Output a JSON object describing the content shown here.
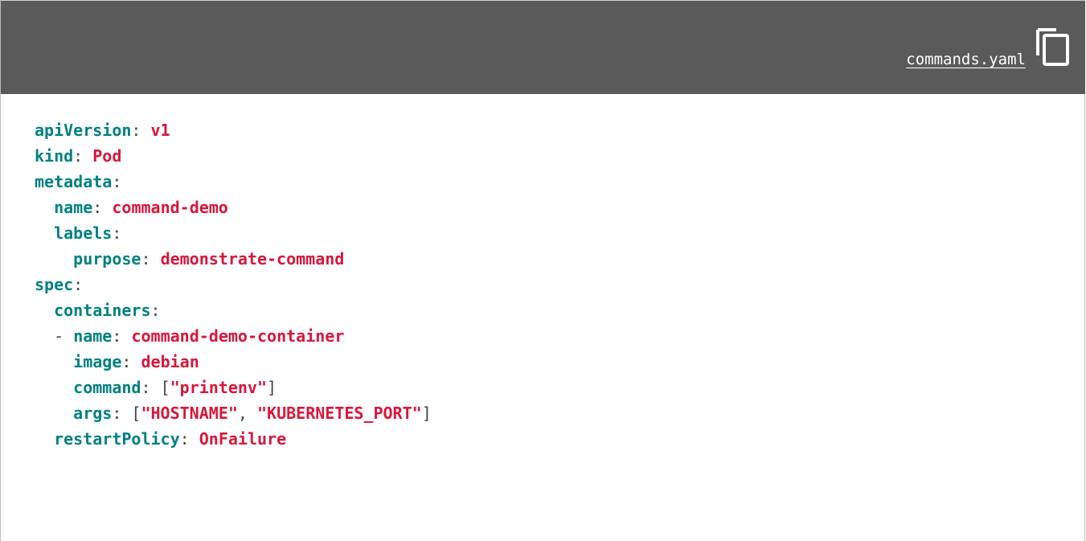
{
  "header": {
    "filename": "commands.yaml",
    "copy_icon": "copy-icon"
  },
  "code": {
    "lines": [
      {
        "indent": "",
        "dash": "",
        "key": "apiVersion",
        "sep": ": ",
        "value": "v1"
      },
      {
        "indent": "",
        "dash": "",
        "key": "kind",
        "sep": ": ",
        "value": "Pod"
      },
      {
        "indent": "",
        "dash": "",
        "key": "metadata",
        "sep": ":",
        "value": ""
      },
      {
        "indent": "  ",
        "dash": "",
        "key": "name",
        "sep": ": ",
        "value": "command-demo"
      },
      {
        "indent": "  ",
        "dash": "",
        "key": "labels",
        "sep": ":",
        "value": ""
      },
      {
        "indent": "    ",
        "dash": "",
        "key": "purpose",
        "sep": ": ",
        "value": "demonstrate-command"
      },
      {
        "indent": "",
        "dash": "",
        "key": "spec",
        "sep": ":",
        "value": ""
      },
      {
        "indent": "  ",
        "dash": "",
        "key": "containers",
        "sep": ":",
        "value": ""
      },
      {
        "indent": "  ",
        "dash": "- ",
        "key": "name",
        "sep": ": ",
        "value": "command-demo-container"
      },
      {
        "indent": "    ",
        "dash": "",
        "key": "image",
        "sep": ": ",
        "value": "debian"
      },
      {
        "indent": "    ",
        "dash": "",
        "key": "command",
        "sep": ": [",
        "value": "\"printenv\"",
        "tail": "]"
      },
      {
        "indent": "    ",
        "dash": "",
        "key": "args",
        "sep": ": [",
        "value": "\"HOSTNAME\"",
        "mid": ", ",
        "value2": "\"KUBERNETES_PORT\"",
        "tail": "]"
      },
      {
        "indent": "  ",
        "dash": "",
        "key": "restartPolicy",
        "sep": ": ",
        "value": "OnFailure"
      }
    ]
  },
  "colors": {
    "header_bg": "#5a5a5a",
    "key": "#008080",
    "value": "#d6173b",
    "punctuation": "#444444"
  }
}
